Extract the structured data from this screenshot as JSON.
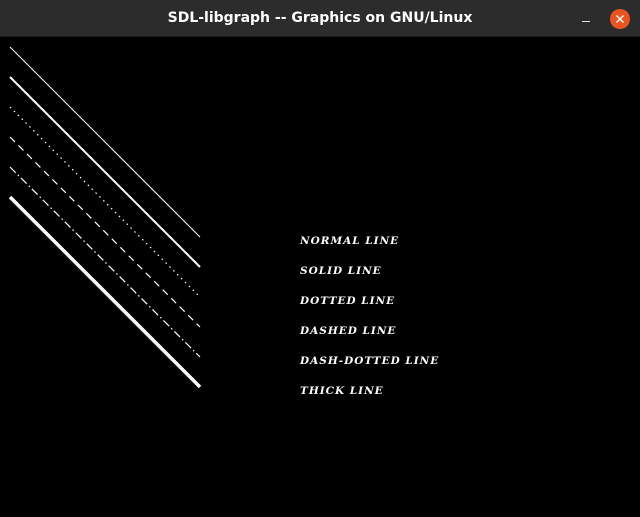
{
  "window": {
    "title": "SDL-libgraph -- Graphics on GNU/Linux",
    "close_color": "#e95420",
    "titlebar_color": "#2c2c2c",
    "background_color": "#000000"
  },
  "canvas": {
    "line_color": "#ffffff",
    "labels": {
      "normal": "NORMAL LINE",
      "solid": "SOLID LINE",
      "dotted": "DOTTED LINE",
      "dashed": "DASHED LINE",
      "dash_dotted": "DASH-DOTTED LINE",
      "thick": "THICK LINE"
    },
    "line_styles": [
      "normal",
      "solid",
      "dotted",
      "dashed",
      "dash-dotted",
      "thick"
    ]
  }
}
